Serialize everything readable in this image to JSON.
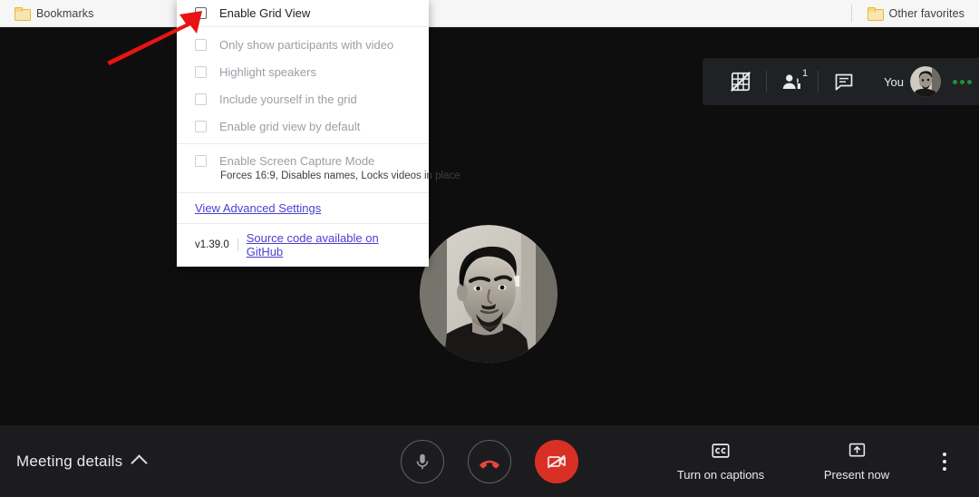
{
  "browser": {
    "bookmarks_label": "Bookmarks",
    "other_favorites_label": "Other favorites",
    "folder_icon": "folder-icon"
  },
  "meet": {
    "top_controls": {
      "grid_toggle_icon": "grid-off-icon",
      "participants_icon": "people-icon",
      "participants_count": "1",
      "chat_icon": "chat-bubble-icon",
      "you_label": "You",
      "avatar_icon": "user-avatar",
      "presence_icon": "presence-dots"
    },
    "stage": {
      "participant_avatar_icon": "participant-photo"
    },
    "bottom_bar": {
      "meeting_details_label": "Meeting details",
      "meeting_details_chevron": "chevron-up-icon",
      "mic_icon": "microphone-icon",
      "hangup_icon": "end-call-icon",
      "camera_icon": "camera-off-icon",
      "captions_label": "Turn on captions",
      "captions_icon": "closed-captions-icon",
      "present_label": "Present now",
      "present_icon": "present-screen-icon",
      "more_options_icon": "more-vertical-icon"
    }
  },
  "grid_popup": {
    "options": [
      {
        "label": "Enable Grid View",
        "checked": false,
        "enabled": true
      },
      {
        "label": "Only show participants with video",
        "checked": false,
        "enabled": false
      },
      {
        "label": "Highlight speakers",
        "checked": false,
        "enabled": false
      },
      {
        "label": "Include yourself in the grid",
        "checked": false,
        "enabled": false
      },
      {
        "label": "Enable grid view by default",
        "checked": false,
        "enabled": false
      },
      {
        "label": "Enable Screen Capture Mode",
        "checked": false,
        "enabled": false
      }
    ],
    "capture_subtitle": "Forces 16:9, Disables names, Locks videos in place",
    "advanced_settings_label": "View Advanced Settings",
    "version_label": "v1.39.0",
    "github_label": "Source code available on GitHub",
    "link_color": "#4b3fd1"
  },
  "annotation": {
    "arrow_icon": "red-arrow-annotation",
    "arrow_color": "#e81313"
  }
}
